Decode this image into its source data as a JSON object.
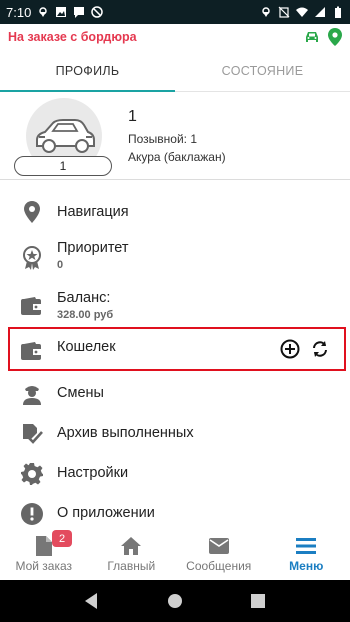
{
  "status_bar": {
    "time": "7:10",
    "left_icons": [
      "location-icon",
      "image-icon",
      "message-icon",
      "no-disturb-icon"
    ],
    "right_icons": [
      "location-icon",
      "no-signal-icon",
      "wifi-icon",
      "signal-icon",
      "battery-icon"
    ]
  },
  "header": {
    "title": "На заказе с бордюра",
    "icons": [
      "car-icon",
      "location-pin-icon"
    ],
    "accent_color": "#e53950"
  },
  "tabs": [
    {
      "label": "ПРОФИЛЬ",
      "active": true
    },
    {
      "label": "СОСТОЯНИЕ",
      "active": false
    }
  ],
  "profile": {
    "car_number_badge": "1",
    "name": "1",
    "callsign": "Позывной: 1",
    "car": "Акура (баклажан)"
  },
  "menu": [
    {
      "label": "Навигация",
      "icon": "location-pin-icon"
    },
    {
      "label": "Приоритет",
      "sub": "0",
      "icon": "award-icon"
    },
    {
      "label": "Баланс:",
      "sub": "328.00 руб",
      "icon": "wallet-icon"
    },
    {
      "label": "Кошелек",
      "icon": "wallet-icon",
      "actions": [
        "add-circle-icon",
        "refresh-icon"
      ]
    },
    {
      "label": "Смены",
      "icon": "driver-icon"
    },
    {
      "label": "Архив выполненных",
      "icon": "archive-check-icon"
    },
    {
      "label": "Настройки",
      "icon": "gear-icon"
    },
    {
      "label": "О приложении",
      "icon": "info-icon"
    }
  ],
  "bottom_nav": [
    {
      "label": "Мой заказ",
      "icon": "document-icon",
      "badge": "2",
      "active": false
    },
    {
      "label": "Главный",
      "icon": "home-icon",
      "active": false
    },
    {
      "label": "Сообщения",
      "icon": "mail-icon",
      "active": false
    },
    {
      "label": "Меню",
      "icon": "menu-icon",
      "active": true
    }
  ],
  "colors": {
    "tab_indicator": "#1aa3a3",
    "active_nav": "#1b7ec2",
    "highlight_box": "#e0101e",
    "badge": "#e34b5e",
    "car_icon": "#2aa84a",
    "location_icon": "#2aa84a"
  }
}
